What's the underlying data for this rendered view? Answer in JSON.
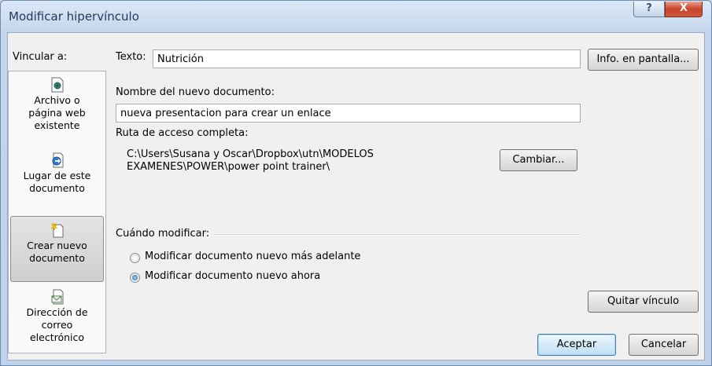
{
  "window": {
    "title": "Modificar hipervínculo",
    "help_glyph": "?",
    "close_glyph": "X"
  },
  "link_to": {
    "label": "Vincular a:",
    "items": [
      {
        "label_line1": "Archivo o",
        "label_line2": "página web",
        "label_line3": "existente",
        "icon": "existing-file-icon",
        "selected": false
      },
      {
        "label_line1": "Lugar de este",
        "label_line2": "documento",
        "icon": "place-in-document-icon",
        "selected": false
      },
      {
        "label_line1": "Crear nuevo",
        "label_line2": "documento",
        "icon": "new-document-icon",
        "selected": true
      },
      {
        "label_line1": "Dirección de",
        "label_line2": "correo",
        "label_line3": "electrónico",
        "icon": "email-address-icon",
        "selected": false
      }
    ]
  },
  "text_field": {
    "label": "Texto:",
    "value": "Nutrición"
  },
  "screentip_button": "Info. en pantalla...",
  "new_document": {
    "label": "Nombre del nuevo documento:",
    "value": "nueva presentacion para crear un enlace"
  },
  "full_path": {
    "label": "Ruta de acceso completa:",
    "line1": "C:\\Users\\Susana y Oscar\\Dropbox\\utn\\MODELOS",
    "line2": "EXAMENES\\POWER\\power point trainer\\"
  },
  "change_button": "Cambiar...",
  "when_edit": {
    "label": "Cuándo modificar:",
    "options": [
      {
        "label": "Modificar documento nuevo más adelante",
        "checked": false
      },
      {
        "label": "Modificar documento nuevo ahora",
        "checked": true
      }
    ]
  },
  "remove_link_button": "Quitar vínculo",
  "ok_button": "Aceptar",
  "cancel_button": "Cancelar"
}
